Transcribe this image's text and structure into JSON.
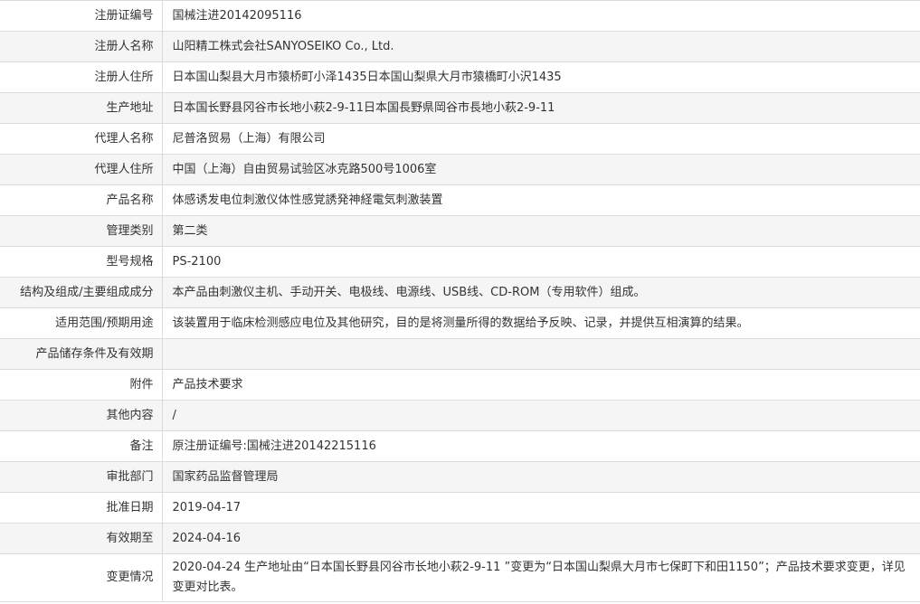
{
  "rows": [
    {
      "label": "注册证编号",
      "value": "国械注进20142095116"
    },
    {
      "label": "注册人名称",
      "value": "山阳精工株式会社SANYOSEIKO Co., Ltd."
    },
    {
      "label": "注册人住所",
      "value": "日本国山梨县大月市猿桥町小泽1435日本国山梨県大月市猿橋町小沢1435"
    },
    {
      "label": "生产地址",
      "value": "日本国长野县冈谷市长地小萩2-9-11日本国長野県岡谷市長地小萩2-9-11"
    },
    {
      "label": "代理人名称",
      "value": "尼普洛贸易（上海）有限公司"
    },
    {
      "label": "代理人住所",
      "value": "中国（上海）自由贸易试验区冰克路500号1006室"
    },
    {
      "label": "产品名称",
      "value": "体感诱发电位刺激仪体性感覚誘発神経電気刺激装置"
    },
    {
      "label": "管理类别",
      "value": "第二类"
    },
    {
      "label": "型号规格",
      "value": "PS-2100"
    },
    {
      "label": "结构及组成/主要组成成分",
      "value": "本产品由刺激仪主机、手动开关、电极线、电源线、USB线、CD-ROM（专用软件）组成。"
    },
    {
      "label": "适用范围/预期用途",
      "value": "该装置用于临床检测感应电位及其他研究，目的是将测量所得的数据给予反映、记录，并提供互相演算的结果。"
    },
    {
      "label": "产品储存条件及有效期",
      "value": ""
    },
    {
      "label": "附件",
      "value": "产品技术要求"
    },
    {
      "label": "其他内容",
      "value": "/"
    },
    {
      "label": "备注",
      "value": "原注册证编号:国械注进20142215116"
    },
    {
      "label": "审批部门",
      "value": "国家药品监督管理局"
    },
    {
      "label": "批准日期",
      "value": "2019-04-17"
    },
    {
      "label": "有效期至",
      "value": "2024-04-16"
    },
    {
      "label": "变更情况",
      "value": "2020-04-24 生产地址由“日本国长野县冈谷市长地小萩2-9-11 ”变更为“日本国山梨県大月市七保町下和田1150”；产品技术要求变更，详见变更对比表。"
    }
  ]
}
